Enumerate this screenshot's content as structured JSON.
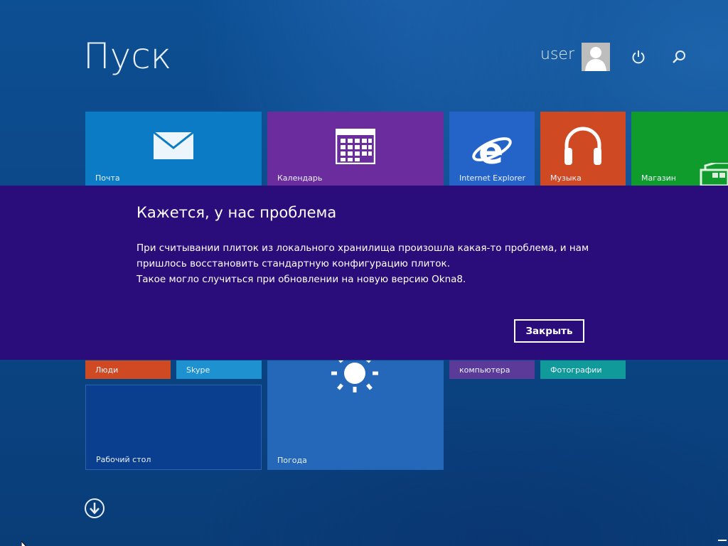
{
  "start": {
    "title": "Пуск",
    "user_name": "user"
  },
  "tiles": {
    "mail": {
      "label": "Почта",
      "color": "#0a7bc4"
    },
    "calendar": {
      "label": "Календарь",
      "color": "#6b2d9e"
    },
    "ie": {
      "label": "Internet Explorer",
      "color": "#2464c8"
    },
    "music": {
      "label": "Музыка",
      "color": "#cf4a23"
    },
    "store": {
      "label": "Магазин",
      "color": "#109b2d"
    },
    "people": {
      "label": "Люди",
      "color": "#cf4a23"
    },
    "skype": {
      "label": "Skype",
      "color": "#1e92d0"
    },
    "pc_settings": {
      "label": "компьютера",
      "color": "#5b3a9a"
    },
    "photos": {
      "label": "Фотографии",
      "color": "#119a9a"
    },
    "desktop": {
      "label": "Рабочий стол",
      "color": "#0a3f8f"
    },
    "weather": {
      "label": "Погода",
      "color": "#2567b8"
    }
  },
  "dialog": {
    "title": "Кажется, у нас проблема",
    "line1": "При считывании плиток из локального хранилища произошла какая-то проблема, и нам",
    "line2": "пришлось восстановить стандартную конфигурацию плиток.",
    "line3": "Такое могло случиться при обновлении на новую версию Okna8.",
    "close_label": "Закрыть",
    "background": "#2a0d7a"
  },
  "icons": {
    "power": "power-icon",
    "search": "search-icon",
    "scroll_down": "arrow-down-circle-icon"
  }
}
